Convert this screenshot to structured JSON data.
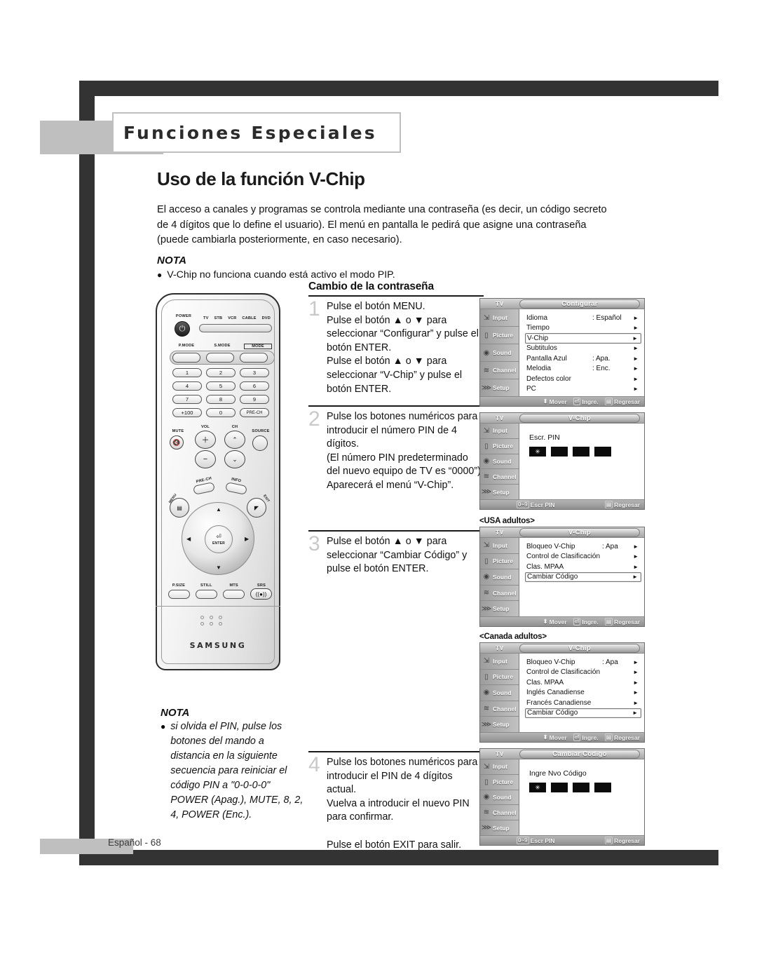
{
  "chapter": {
    "title": "Funciones Especiales"
  },
  "page": {
    "heading": "Uso de la función V-Chip",
    "intro": "El acceso a canales y programas se controla mediante una contraseña (es decir, un código secreto de 4 dígitos que lo define el usuario). El menú en pantalla le pedirá que asigne una contraseña (puede cambiarla posteriormente, en caso necesario).",
    "nota_label": "NOTA",
    "nota_bullet": "V-Chip no funciona cuando está activo el modo PIP.",
    "footer": "Español - 68"
  },
  "section": {
    "subtitle": "Cambio de la contraseña"
  },
  "steps": [
    {
      "num": "1",
      "text": "Pulse el botón MENU.\nPulse el botón ▲ o ▼ para seleccionar “Configurar” y pulse el botón ENTER.\nPulse el botón ▲ o ▼ para seleccionar “V-Chip” y pulse el botón ENTER."
    },
    {
      "num": "2",
      "text": "Pulse los botones numéricos para introducir el número PIN de 4 dígitos.\n(El número PIN predeterminado del nuevo equipo de TV es “0000”)\nAparecerá el menú “V-Chip”."
    },
    {
      "num": "3",
      "text": "Pulse el botón ▲ o ▼ para seleccionar “Cambiar Código” y pulse el botón ENTER."
    },
    {
      "num": "4",
      "text": "Pulse los botones numéricos para introducir el PIN de 4 dígitos actual.\nVuelva a introducir el nuevo PIN para confirmar.\n\nPulse el botón EXIT para salir."
    }
  ],
  "nota2": {
    "label": "NOTA",
    "text": "si olvida el PIN, pulse los botones del mando a distancia en la siguiente secuencia para reiniciar el código PIN a \"0-0-0-0\" POWER (Apag.), MUTE, 8, 2, 4, POWER (Enc.)."
  },
  "osd_sidebar": [
    {
      "icon": "input-icon",
      "label": "Input"
    },
    {
      "icon": "picture-icon",
      "label": "Picture"
    },
    {
      "icon": "sound-icon",
      "label": "Sound"
    },
    {
      "icon": "channel-icon",
      "label": "Channel"
    },
    {
      "icon": "setup-icon",
      "label": "Setup"
    }
  ],
  "osd_footer_nav": {
    "move": "Mover",
    "enter": "Ingre.",
    "return": "Regresar",
    "pin": "Escr PIN",
    "pin_keys": "0~9"
  },
  "screens": [
    {
      "id": "configurar",
      "caption": "",
      "tv_label": "TV",
      "title": "Configurar",
      "rows": [
        {
          "label": "Idioma",
          "value": ": Español",
          "arrow": "►",
          "selected": false
        },
        {
          "label": "Tiempo",
          "value": "",
          "arrow": "►",
          "selected": false
        },
        {
          "label": "V-Chip",
          "value": "",
          "arrow": "►",
          "selected": true
        },
        {
          "label": "Subtitulos",
          "value": "",
          "arrow": "►",
          "selected": false
        },
        {
          "label": "Pantalla Azul",
          "value": ": Apa.",
          "arrow": "►",
          "selected": false
        },
        {
          "label": "Melodia",
          "value": ": Enc.",
          "arrow": "►",
          "selected": false
        },
        {
          "label": "Defectos color",
          "value": "",
          "arrow": "►",
          "selected": false
        },
        {
          "label": "PC",
          "value": "",
          "arrow": "►",
          "selected": false
        }
      ],
      "footer_type": "nav"
    },
    {
      "id": "vchip-pin",
      "caption": "",
      "tv_label": "TV",
      "title": "V-Chip",
      "pin_label": "Escr. PIN",
      "pin_filled": 1,
      "pin_total": 4,
      "footer_type": "pin"
    },
    {
      "id": "vchip-usa",
      "caption": "<USA adultos>",
      "tv_label": "TV",
      "title": "V-Chip",
      "rows": [
        {
          "label": "Bloqueo V-Chip",
          "value": ": Apa",
          "arrow": "►",
          "selected": false
        },
        {
          "label": "Control de Clasificación",
          "value": "",
          "arrow": "►",
          "selected": false
        },
        {
          "label": "Clas. MPAA",
          "value": "",
          "arrow": "►",
          "selected": false
        },
        {
          "label": "Cambiar Código",
          "value": "",
          "arrow": "►",
          "selected": true
        }
      ],
      "footer_type": "nav"
    },
    {
      "id": "vchip-canada",
      "caption": "<Canada adultos>",
      "tv_label": "TV",
      "title": "V-Chip",
      "rows": [
        {
          "label": "Bloqueo V-Chip",
          "value": ": Apa",
          "arrow": "►",
          "selected": false
        },
        {
          "label": "Control de Clasificación",
          "value": "",
          "arrow": "►",
          "selected": false
        },
        {
          "label": "Clas. MPAA",
          "value": "",
          "arrow": "►",
          "selected": false
        },
        {
          "label": "Inglés Canadiense",
          "value": "",
          "arrow": "►",
          "selected": false
        },
        {
          "label": "Francés Canadiense",
          "value": "",
          "arrow": "►",
          "selected": false
        },
        {
          "label": "Cambiar Código",
          "value": "",
          "arrow": "►",
          "selected": true
        }
      ],
      "footer_type": "nav"
    },
    {
      "id": "cambiar-codigo",
      "caption": "",
      "tv_label": "TV",
      "title": "Cambiar Código",
      "pin_label": "Ingre Nvo Código",
      "pin_filled": 1,
      "pin_total": 4,
      "footer_type": "pin"
    }
  ],
  "remote": {
    "brand": "SAMSUNG",
    "power_label": "POWER",
    "device_modes": [
      "TV",
      "STB",
      "VCR",
      "CABLE",
      "DVD"
    ],
    "mode_row": [
      "P.MODE",
      "S.MODE",
      "MODE"
    ],
    "numpad": [
      "1",
      "2",
      "3",
      "4",
      "5",
      "6",
      "7",
      "8",
      "9",
      "+100",
      "0",
      "PRE-CH"
    ],
    "mute_label": "MUTE",
    "vol_label": "VOL",
    "ch_label": "CH",
    "source_label": "SOURCE",
    "prech_label": "PRE-CH",
    "info_label": "INFO",
    "menu_label": "MENU",
    "exit_label": "EXIT",
    "enter_label": "ENTER",
    "bottom_row": [
      "P.SIZE",
      "STILL",
      "MTS",
      "SRS"
    ]
  }
}
